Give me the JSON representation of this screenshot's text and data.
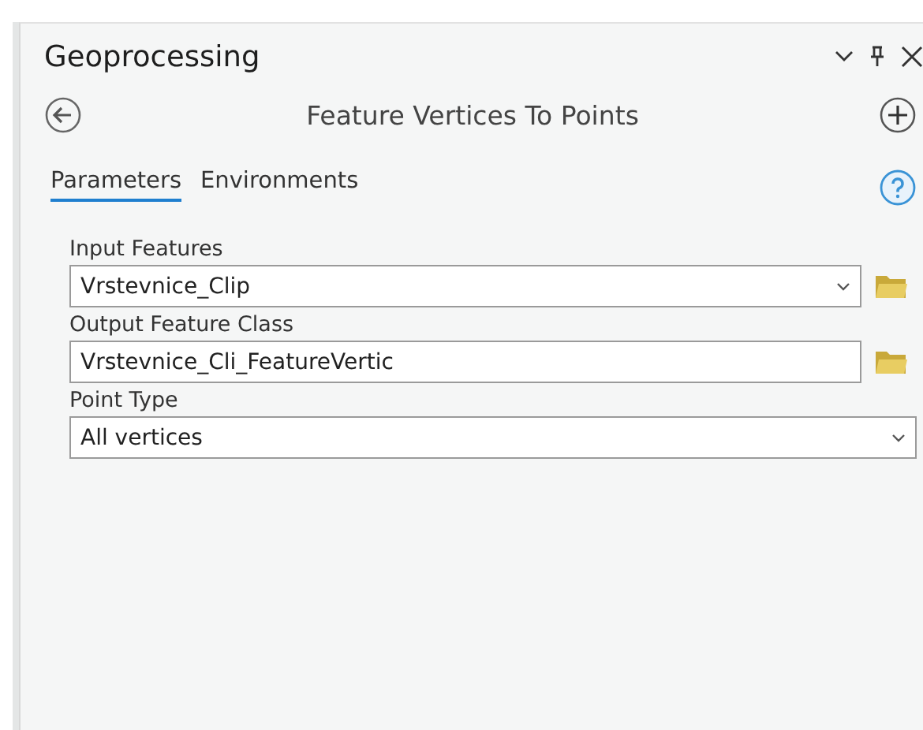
{
  "pane": {
    "title": "Geoprocessing"
  },
  "tool": {
    "title": "Feature Vertices To Points"
  },
  "tabs": [
    {
      "label": "Parameters",
      "selected": true
    },
    {
      "label": "Environments",
      "selected": false
    }
  ],
  "parameters": [
    {
      "label": "Input Features",
      "kind": "dropdown",
      "value": "Vrstevnice_Clip",
      "browse": true
    },
    {
      "label": "Output Feature Class",
      "kind": "text",
      "value": "Vrstevnice_Cli_FeatureVertic",
      "browse": true
    },
    {
      "label": "Point Type",
      "kind": "dropdown",
      "value": "All vertices",
      "browse": false
    }
  ]
}
